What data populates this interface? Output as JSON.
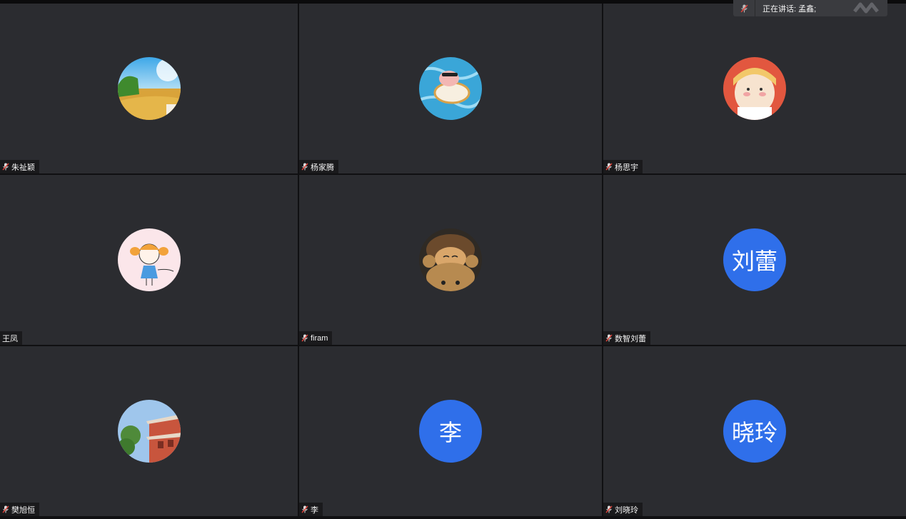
{
  "speaking_indicator": {
    "label": "正在讲话: 孟鑫;"
  },
  "participants": [
    {
      "name": "朱祉颖",
      "avatar": "wheat-field-photo",
      "muted": true
    },
    {
      "name": "杨家腾",
      "avatar": "pig-in-pool-photo",
      "muted": true
    },
    {
      "name": "杨思宇",
      "avatar": "anime-girl-photo",
      "muted": true
    },
    {
      "name": "王凤",
      "avatar": "cartoon-girl-drawing",
      "muted": false
    },
    {
      "name": "firam",
      "avatar": "dog-in-bear-hat-photo",
      "muted": true
    },
    {
      "name": "数智刘蕾",
      "avatar_text": "刘蕾",
      "muted": true
    },
    {
      "name": "樊旭恒",
      "avatar": "pagoda-building-photo",
      "muted": true
    },
    {
      "name": "李",
      "avatar_text": "李",
      "muted": true
    },
    {
      "name": "刘晓玲",
      "avatar_text": "晓玲",
      "muted": true
    }
  ],
  "colors": {
    "tile_bg": "#2b2c30",
    "text_avatar_bg": "#2f6fea",
    "mute_red": "#e0433a"
  }
}
